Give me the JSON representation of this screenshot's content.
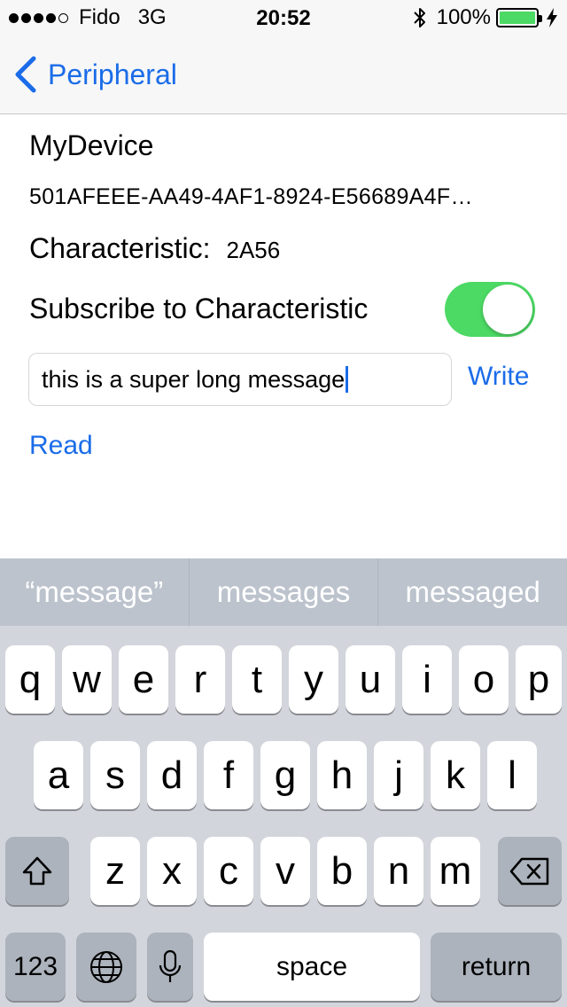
{
  "status_bar": {
    "carrier": "Fido",
    "network": "3G",
    "time": "20:52",
    "battery": "100%",
    "signal_bars_filled": 4,
    "signal_bars_total": 5,
    "battery_level": 1.0,
    "icons": [
      "bluetooth-icon",
      "battery-icon",
      "charging-icon"
    ]
  },
  "nav": {
    "back_label": "Peripheral",
    "back_icon": "chevron-left-icon"
  },
  "device": {
    "name": "MyDevice",
    "uuid": "501AFEEE-AA49-4AF1-8924-E56689A4F…",
    "characteristic_label": "Characteristic:",
    "characteristic_value": "2A56",
    "subscribe_label": "Subscribe to Characteristic",
    "subscribe_on": true
  },
  "message": {
    "value": "this is a super long message",
    "write_label": "Write",
    "read_label": "Read"
  },
  "predictive": [
    "“message”",
    "messages",
    "messaged"
  ],
  "keyboard": {
    "row1": [
      "q",
      "w",
      "e",
      "r",
      "t",
      "y",
      "u",
      "i",
      "o",
      "p"
    ],
    "row2": [
      "a",
      "s",
      "d",
      "f",
      "g",
      "h",
      "j",
      "k",
      "l"
    ],
    "row3": [
      "z",
      "x",
      "c",
      "v",
      "b",
      "n",
      "m"
    ],
    "numbers_label": "123",
    "space_label": "space",
    "return_label": "return",
    "icons": [
      "shift-icon",
      "delete-icon",
      "globe-icon",
      "microphone-icon"
    ]
  },
  "colors": {
    "accent": "#1a6ce8",
    "toggle_on": "#4cd964",
    "battery": "#4cd964",
    "keyboard_bg": "#d2d5db",
    "predictive_bg": "#bcc3cd"
  }
}
